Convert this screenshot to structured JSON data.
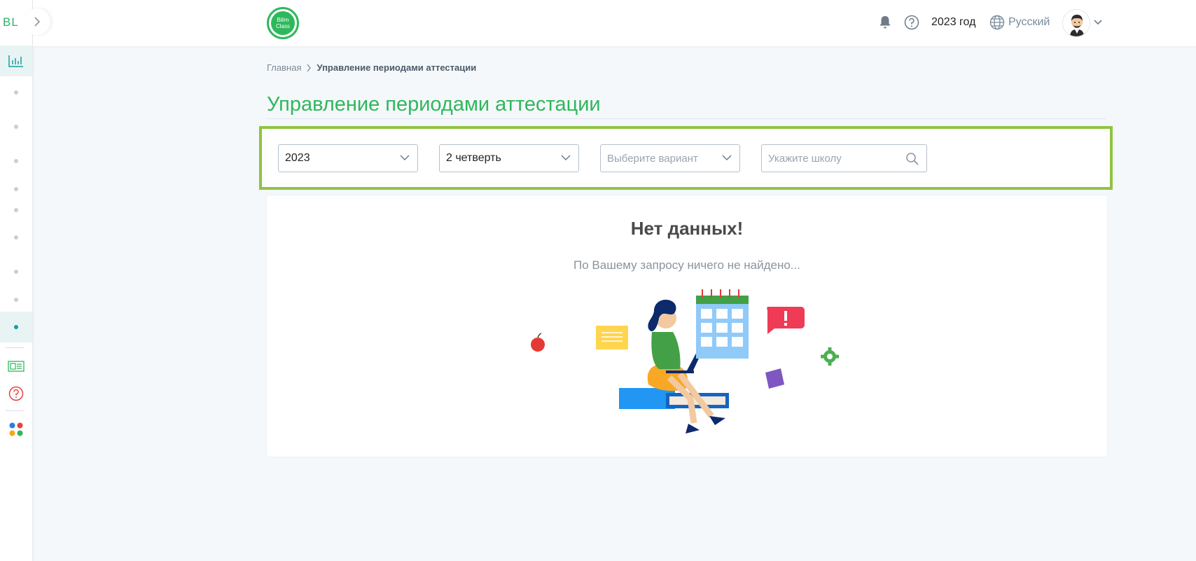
{
  "sidebar": {
    "logo_text": "BL",
    "toggle_icon": "chevron-right-icon",
    "items": [
      {
        "icon": "chart-icon"
      },
      {
        "icon": "dot"
      },
      {
        "icon": "dot"
      },
      {
        "icon": "dot"
      },
      {
        "icon": "dot"
      },
      {
        "icon": "dot"
      },
      {
        "icon": "dot"
      },
      {
        "icon": "dot"
      },
      {
        "icon": "dot"
      },
      {
        "icon": "dot",
        "active": true
      },
      {
        "icon": "news-icon"
      },
      {
        "icon": "help-icon"
      },
      {
        "icon": "apps-icon"
      }
    ],
    "active_color": "#1a9b9b"
  },
  "header": {
    "brand_line1": "Bilim",
    "brand_line2": "Class",
    "year_label": "2023 год",
    "language": "Русский",
    "icons": [
      "bell-icon",
      "help-icon",
      "globe-icon",
      "avatar",
      "chevron-down-icon"
    ]
  },
  "breadcrumb": {
    "home": "Главная",
    "current": "Управление периодами аттестации"
  },
  "page": {
    "title": "Управление периодами аттестации",
    "accent": "#2eb85c",
    "highlight_border": "#8fc43f"
  },
  "filters": {
    "year_value": "2023",
    "quarter_value": "2 четверть",
    "variant_placeholder": "Выберите вариант",
    "school_placeholder": "Укажите школу"
  },
  "empty_state": {
    "title": "Нет данных!",
    "message": "По Вашему запросу ничего не найдено..."
  }
}
